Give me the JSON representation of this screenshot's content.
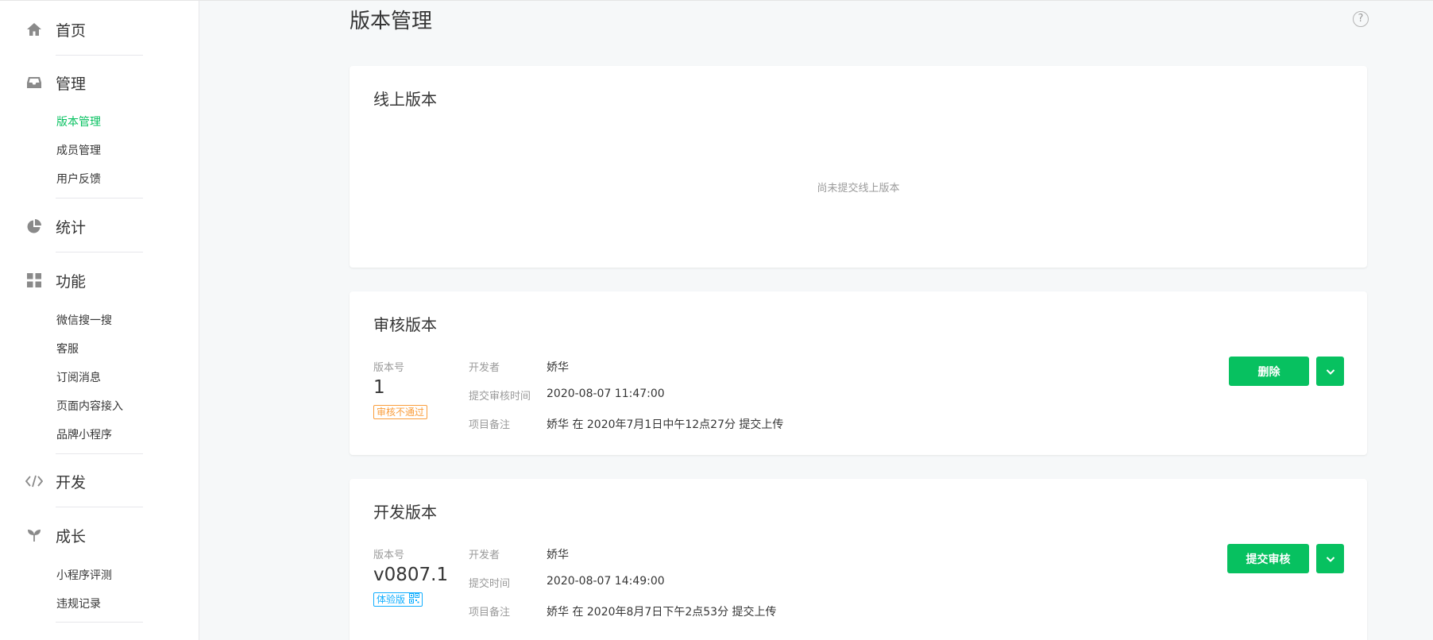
{
  "sidebar": {
    "home": {
      "label": "首页",
      "icon": "home-icon"
    },
    "manage": {
      "label": "管理",
      "icon": "inbox-icon",
      "items": [
        "版本管理",
        "成员管理",
        "用户反馈"
      ]
    },
    "stats": {
      "label": "统计",
      "icon": "pie-chart-icon"
    },
    "features": {
      "label": "功能",
      "icon": "grid-icon",
      "items": [
        "微信搜一搜",
        "客服",
        "订阅消息",
        "页面内容接入",
        "品牌小程序"
      ]
    },
    "develop": {
      "label": "开发",
      "icon": "code-icon"
    },
    "growth": {
      "label": "成长",
      "icon": "sprout-icon",
      "items": [
        "小程序评测",
        "违规记录"
      ]
    }
  },
  "main": {
    "title": "版本管理",
    "help": "?",
    "online": {
      "title": "线上版本",
      "empty": "尚未提交线上版本"
    },
    "review": {
      "title": "审核版本",
      "version_label": "版本号",
      "version": "1",
      "status": "审核不通过",
      "fields": [
        {
          "key": "开发者",
          "value": "娇华"
        },
        {
          "key": "提交审核时间",
          "value": "2020-08-07 11:47:00"
        },
        {
          "key": "项目备注",
          "value": "娇华 在 2020年7月1日中午12点27分 提交上传"
        }
      ],
      "primary_button": "删除"
    },
    "dev": {
      "title": "开发版本",
      "version_label": "版本号",
      "version": "v0807.1",
      "status": "体验版",
      "fields": [
        {
          "key": "开发者",
          "value": "娇华"
        },
        {
          "key": "提交时间",
          "value": "2020-08-07 14:49:00"
        },
        {
          "key": "项目备注",
          "value": "娇华 在 2020年8月7日下午2点53分 提交上传"
        }
      ],
      "primary_button": "提交审核"
    }
  },
  "colors": {
    "accent": "#07c160",
    "warning": "#fa9d3b",
    "info": "#10aeff",
    "icon_gray": "#8a8a8a"
  }
}
